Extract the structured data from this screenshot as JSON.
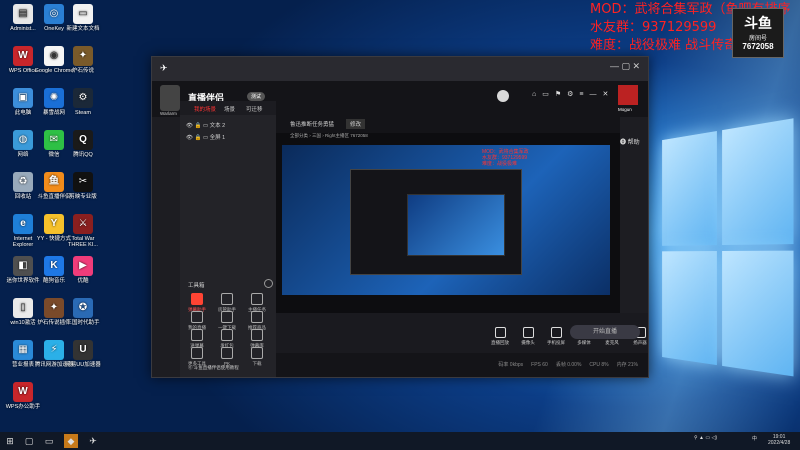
{
  "desktop_icons": [
    {
      "label": "Administ...",
      "color": "#e8e8e8",
      "glyph": "▤"
    },
    {
      "label": "OneKey",
      "color": "#2a7fd4",
      "glyph": "◎"
    },
    {
      "label": "新建文本文档",
      "color": "#f2f2f2",
      "glyph": "▭"
    },
    {
      "label": "WPS Office",
      "color": "#c8262b",
      "glyph": "W"
    },
    {
      "label": "Google Chrome",
      "color": "#f5f5f5",
      "glyph": "◉"
    },
    {
      "label": "炉石传说",
      "color": "#7a5a2a",
      "glyph": "✦"
    },
    {
      "label": "此电脑",
      "color": "#3c8edb",
      "glyph": "▣"
    },
    {
      "label": "暴雪战网",
      "color": "#1a6fd6",
      "glyph": "✺"
    },
    {
      "label": "Steam",
      "color": "#1b2838",
      "glyph": "⚙"
    },
    {
      "label": "网络",
      "color": "#3a9ad9",
      "glyph": "◍"
    },
    {
      "label": "微信",
      "color": "#2ec045",
      "glyph": "✉"
    },
    {
      "label": "腾讯QQ",
      "color": "#1a1a1a",
      "glyph": "Q"
    },
    {
      "label": "回收站",
      "color": "#9ab",
      "glyph": "♻"
    },
    {
      "label": "斗鱼直播伴侣",
      "color": "#f28c1b",
      "glyph": "鱼"
    },
    {
      "label": "剪映专业版",
      "color": "#111",
      "glyph": "✂"
    },
    {
      "label": "Internet Explorer",
      "color": "#1e7fd8",
      "glyph": "e"
    },
    {
      "label": "YY - 快捷方式",
      "color": "#f6c12b",
      "glyph": "Y"
    },
    {
      "label": "Total War THREE KI...",
      "color": "#8a1f1f",
      "glyph": "⚔"
    },
    {
      "label": "迷你世界软件",
      "color": "#4f4f4f",
      "glyph": "◧"
    },
    {
      "label": "酷狗音乐",
      "color": "#1e78e6",
      "glyph": "K"
    },
    {
      "label": "优酷",
      "color": "#f03c7a",
      "glyph": "▶"
    },
    {
      "label": "win10激活",
      "color": "#eaeaea",
      "glyph": "▯"
    },
    {
      "label": "炉石传说插件",
      "color": "#7a4a2a",
      "glyph": "✦"
    },
    {
      "label": "三国时代助手",
      "color": "#2a6ab5",
      "glyph": "✪"
    },
    {
      "label": "营业报表",
      "color": "#2a8ad8",
      "glyph": "▦"
    },
    {
      "label": "腾讯网游加速器",
      "color": "#2bb0e8",
      "glyph": "⚡"
    },
    {
      "label": "网易UU加速器",
      "color": "#333",
      "glyph": "U"
    },
    {
      "label": "WPS办公助手",
      "color": "#c8262b",
      "glyph": "W"
    }
  ],
  "overlay": {
    "line1": "MOD：武将合集军政（鱼吧有排序",
    "line2": "水友群：937129599",
    "line3": "难度：战役极难 战斗传奇",
    "badge_title": "斗鱼",
    "badge_sub": "房间号",
    "room": "7672058"
  },
  "app": {
    "logo": "直播伴侣",
    "version": "测试",
    "streamer_name": "Warlarm",
    "right_user": "Mogun",
    "tabs": [
      "我的场景",
      "场景",
      "可迁移"
    ],
    "scenes": [
      {
        "label": "文本 2"
      },
      {
        "label": "全屏 1"
      }
    ],
    "tools_header": "工具箱",
    "tools": [
      {
        "label": "弹幕助手"
      },
      {
        "label": "房管助手"
      },
      {
        "label": "主播任务"
      },
      {
        "label": "我的直播"
      },
      {
        "label": "一键下载"
      },
      {
        "label": "推荐商品"
      },
      {
        "label": "送弹幕"
      },
      {
        "label": "发红包"
      },
      {
        "label": "弹幕库"
      },
      {
        "label": "更多工具"
      },
      {
        "label": "PK"
      },
      {
        "label": "下载"
      }
    ],
    "notice": "斗鱼直播伴侣使用教程",
    "stream_title": "鲁迅推断任务勇猛",
    "edit_btn": "修改",
    "sub_info": "全部分类 › 三国 › Right主播区 7672058",
    "bottom_buttons": [
      "直播回放",
      "摄像头",
      "手机投屏",
      "多媒体",
      "麦克风",
      "扬声器"
    ],
    "start_btn": "开始直播",
    "status": [
      "码率 0kbps",
      "FPS 60",
      "丢帧 0.00%",
      "CPU 8%",
      "内存 21%"
    ],
    "help": "帮助",
    "stat_badge": "4"
  },
  "taskbar": {
    "time": "19:01",
    "date": "2022/4/28",
    "lang": "中"
  }
}
